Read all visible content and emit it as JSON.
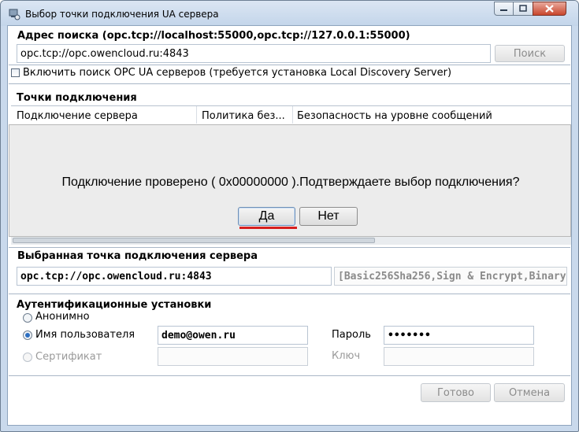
{
  "window": {
    "title": "Выбор точки подключения UA сервера"
  },
  "search": {
    "heading": "Адрес поиска (opc.tcp://localhost:55000,opc.tcp://127.0.0.1:55000)",
    "value": "opc.tcp://opc.owencloud.ru:4843",
    "button_label": "Поиск",
    "lds_checkbox_label": "Включить поиск OPC UA серверов (требуется установка Local Discovery Server)",
    "lds_checked": false
  },
  "endpoints": {
    "heading": "Точки подключения",
    "columns": [
      "Подключение сервера",
      "Политика без...",
      "Безопасность на уровне сообщений"
    ]
  },
  "dialog": {
    "message": "Подключение проверено ( 0x00000000 ).Подтверждаете выбор подключения?",
    "yes_label": "Да",
    "no_label": "Нет"
  },
  "selected": {
    "heading": "Выбранная точка подключения сервера",
    "url": "opc.tcp://opc.owencloud.ru:4843",
    "policy": "[Basic256Sha256,Sign & Encrypt,Binary"
  },
  "auth": {
    "heading": "Аутентификационные установки",
    "anonymous_label": "Анонимно",
    "username_label": "Имя пользователя",
    "username_value": "demo@owen.ru",
    "password_label": "Пароль",
    "password_value": "•••••••",
    "certificate_label": "Сертификат",
    "key_label": "Ключ",
    "selected_mode": "username"
  },
  "footer": {
    "ok_label": "Готово",
    "cancel_label": "Отмена"
  },
  "colors": {
    "accent_red": "#d61f1f",
    "radio_dot": "#2d6fc1"
  },
  "icons": [
    "app-icon",
    "minimize-icon",
    "maximize-icon",
    "close-icon"
  ]
}
